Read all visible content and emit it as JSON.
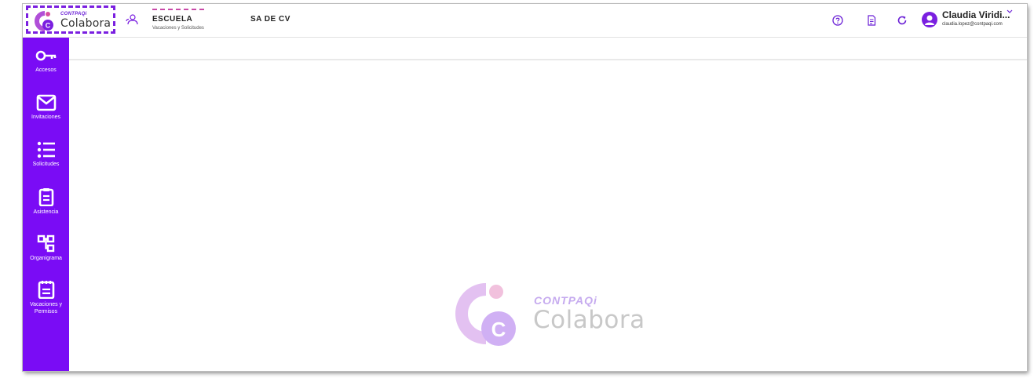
{
  "header": {
    "logo": {
      "brand": "CONTPAQi",
      "name": "Colabora"
    },
    "company": {
      "name": "ESCUELA",
      "subtitle": "Vacaciones y Solicitudes",
      "suffix": "SA DE CV"
    },
    "icons": [
      "help-icon",
      "document-icon",
      "refresh-icon"
    ],
    "user": {
      "name": "Claudia Viridi...",
      "email": "claudia.lopez@contpaqi.com"
    }
  },
  "sidebar": {
    "items": [
      {
        "label": "Accesos",
        "icon": "key-icon"
      },
      {
        "label": "Invitaciones",
        "icon": "envelope-icon"
      },
      {
        "label": "Solicitudes",
        "icon": "list-icon"
      },
      {
        "label": "Asistencia",
        "icon": "clipboard-icon"
      },
      {
        "label": "Organigrama",
        "icon": "org-chart-icon"
      },
      {
        "label": "Vacaciones y Permisos",
        "icon": "calendar-icon"
      }
    ]
  },
  "watermark": {
    "brand": "CONTPAQi",
    "name": "Colabora"
  },
  "colors": {
    "accent": "#7a0cf5",
    "logo_purple": "#7a1fe0",
    "logo_pink": "#d84fa0"
  }
}
